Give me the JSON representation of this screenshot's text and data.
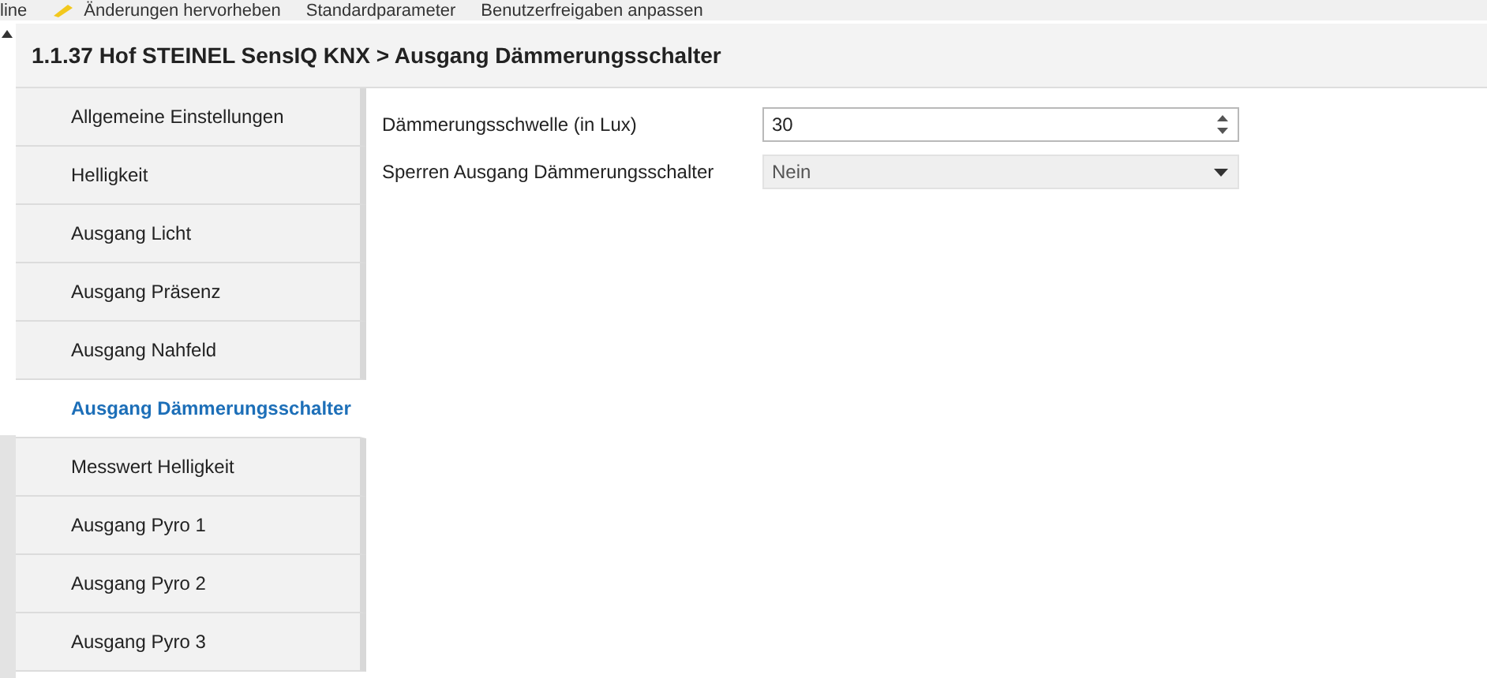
{
  "toolbar": {
    "items": [
      {
        "label": "line",
        "icon": false
      },
      {
        "label": "Änderungen hervorheben",
        "icon": true
      },
      {
        "label": "Standardparameter",
        "icon": false
      },
      {
        "label": "Benutzerfreigaben anpassen",
        "icon": false
      }
    ]
  },
  "header": {
    "title": "1.1.37 Hof STEINEL SensIQ KNX > Ausgang Dämmerungsschalter"
  },
  "sidebar": {
    "items": [
      {
        "label": "Allgemeine Einstellungen",
        "selected": false
      },
      {
        "label": "Helligkeit",
        "selected": false
      },
      {
        "label": "Ausgang Licht",
        "selected": false
      },
      {
        "label": "Ausgang Präsenz",
        "selected": false
      },
      {
        "label": "Ausgang Nahfeld",
        "selected": false
      },
      {
        "label": "Ausgang Dämmerungsschalter",
        "selected": true
      },
      {
        "label": "Messwert Helligkeit",
        "selected": false
      },
      {
        "label": "Ausgang Pyro 1",
        "selected": false
      },
      {
        "label": "Ausgang Pyro 2",
        "selected": false
      },
      {
        "label": "Ausgang Pyro 3",
        "selected": false
      }
    ]
  },
  "parameters": [
    {
      "kind": "spinner",
      "label": "Dämmerungsschwelle (in Lux)",
      "value": "30"
    },
    {
      "kind": "dropdown",
      "label": "Sperren Ausgang Dämmerungsschalter",
      "value": "Nein"
    }
  ]
}
